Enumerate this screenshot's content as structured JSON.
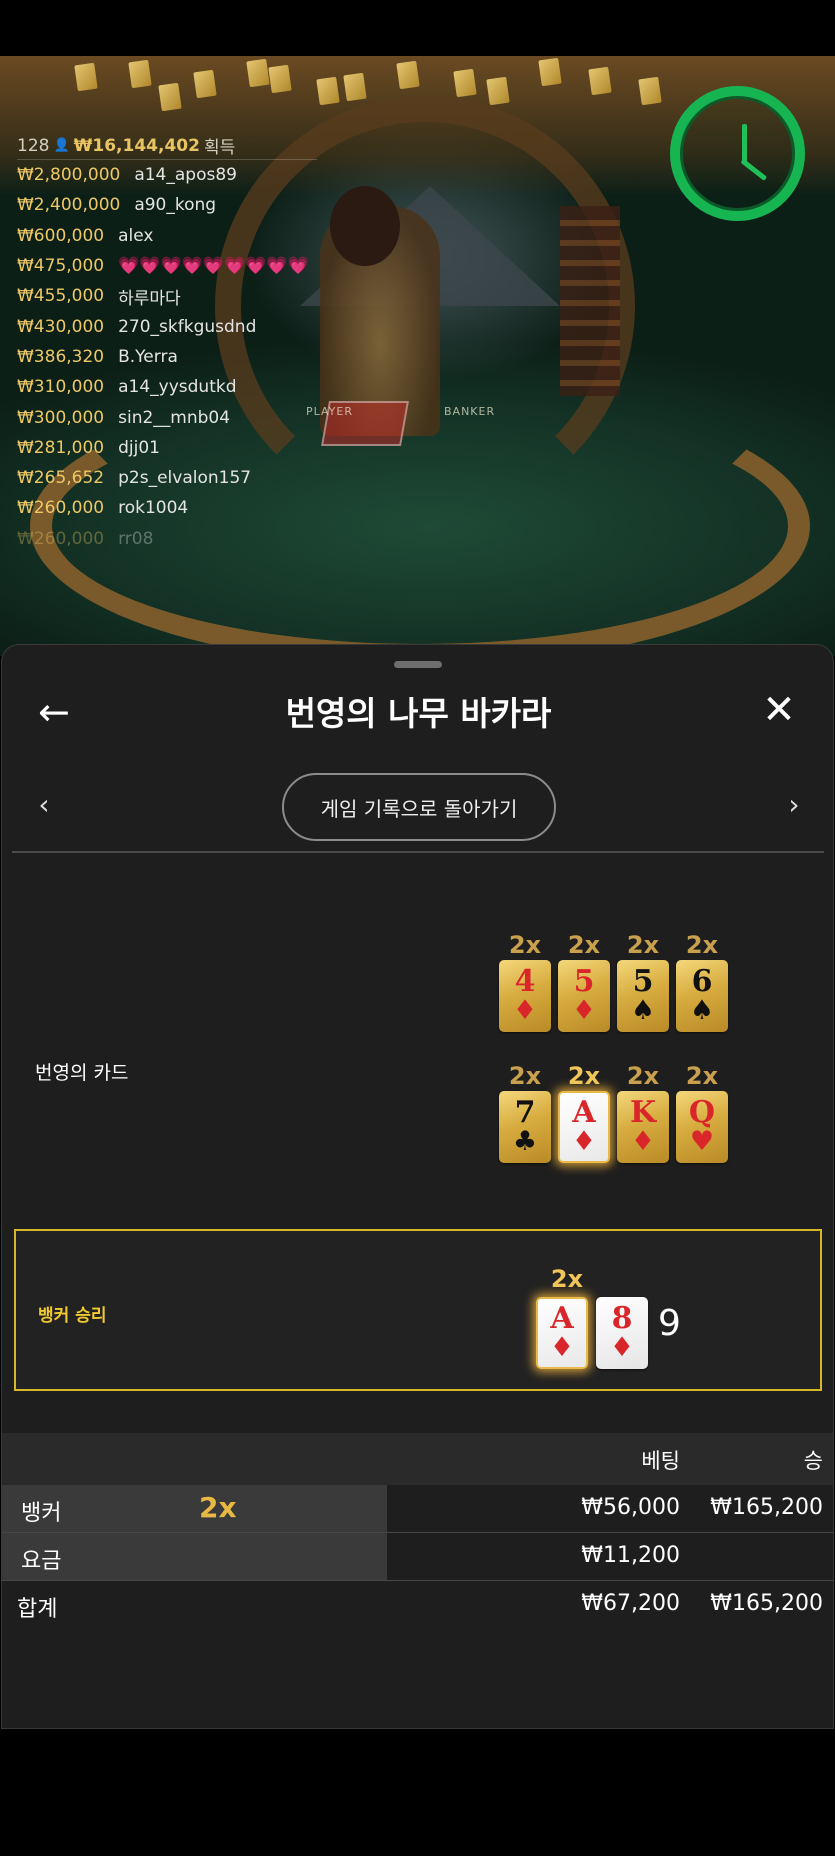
{
  "winners": {
    "count": "128",
    "total": "₩16,144,402",
    "total_suffix": "획득",
    "rows": [
      {
        "amount": "₩2,800,000",
        "name": "a14_apos89"
      },
      {
        "amount": "₩2,400,000",
        "name": "a90_kong"
      },
      {
        "amount": "₩600,000",
        "name": "alex"
      },
      {
        "amount": "₩475,000",
        "name": "💗💗💗💗💗💗💗💗💗"
      },
      {
        "amount": "₩455,000",
        "name": "하루마다"
      },
      {
        "amount": "₩430,000",
        "name": "270_skfkgusdnd"
      },
      {
        "amount": "₩386,320",
        "name": "B.Yerra"
      },
      {
        "amount": "₩310,000",
        "name": "a14_yysdutkd"
      },
      {
        "amount": "₩300,000",
        "name": "sin2__mnb04"
      },
      {
        "amount": "₩281,000",
        "name": "djj01"
      },
      {
        "amount": "₩265,652",
        "name": "p2s_elvalon157"
      },
      {
        "amount": "₩260,000",
        "name": "rok1004"
      },
      {
        "amount": "₩260,000",
        "name": "rr08"
      }
    ]
  },
  "table_labels": {
    "player": "PLAYER",
    "banker": "BANKER"
  },
  "sheet": {
    "title": "번영의 나무 바카라",
    "back_icon": "←",
    "close_icon": "✕",
    "prev_icon": "‹",
    "next_icon": "›",
    "history_button": "게임 기록으로 돌아가기"
  },
  "lucky": {
    "label": "번영의 카드",
    "row1": [
      {
        "mult": "2x",
        "rank": "4",
        "suit": "♦",
        "color": "red"
      },
      {
        "mult": "2x",
        "rank": "5",
        "suit": "♦",
        "color": "red"
      },
      {
        "mult": "2x",
        "rank": "5",
        "suit": "♠",
        "color": "black"
      },
      {
        "mult": "2x",
        "rank": "6",
        "suit": "♠",
        "color": "black"
      }
    ],
    "row2": [
      {
        "mult": "2x",
        "rank": "7",
        "suit": "♣",
        "color": "black"
      },
      {
        "mult": "2x",
        "rank": "A",
        "suit": "♦",
        "color": "red",
        "highlight": true
      },
      {
        "mult": "2x",
        "rank": "K",
        "suit": "♦",
        "color": "red"
      },
      {
        "mult": "2x",
        "rank": "Q",
        "suit": "♥",
        "color": "red"
      }
    ]
  },
  "result": {
    "label": "뱅커 승리",
    "mult": "2x",
    "cards": [
      {
        "rank": "A",
        "suit": "♦",
        "highlight": true
      },
      {
        "rank": "8",
        "suit": "♦",
        "highlight": false
      }
    ],
    "score": "9"
  },
  "bets": {
    "col_bet": "베팅",
    "col_win": "승",
    "rows": [
      {
        "label": "뱅커",
        "mult": "2x",
        "bet": "₩56,000",
        "win": "₩165,200"
      },
      {
        "label": "요금",
        "mult": "",
        "bet": "₩11,200",
        "win": ""
      }
    ],
    "total": {
      "label": "합계",
      "bet": "₩67,200",
      "win": "₩165,200"
    }
  },
  "colors": {
    "accent_gold": "#e8b845",
    "result_border": "#d7b72a",
    "timer_green": "#17b552"
  },
  "icons": {
    "timer": "clock-icon",
    "back": "arrow-left-icon",
    "close": "close-icon"
  }
}
